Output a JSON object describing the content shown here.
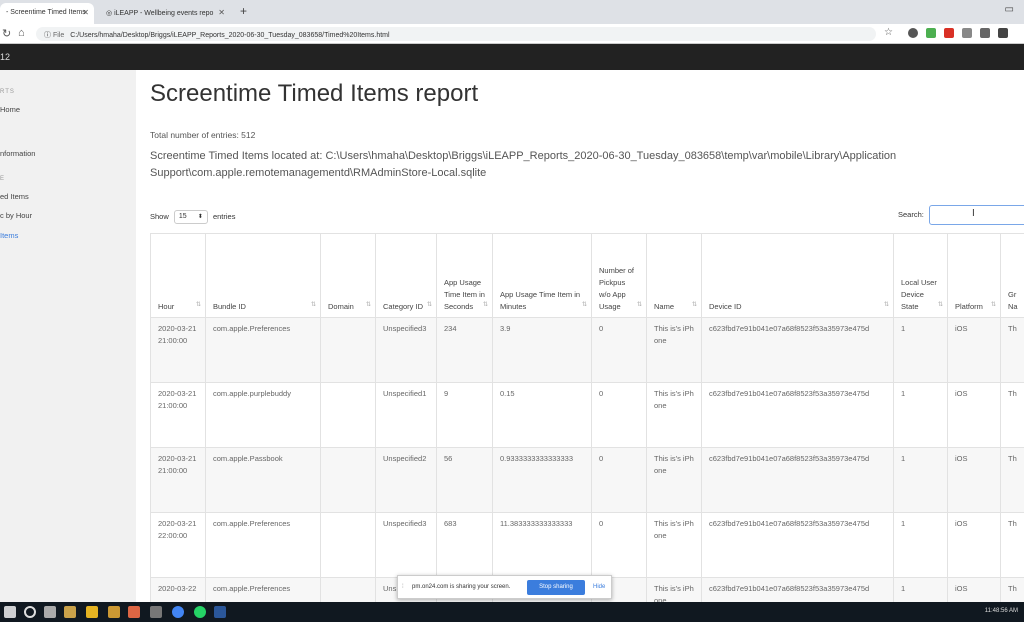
{
  "browser": {
    "tabs": [
      {
        "label": "- Screentime Timed Items",
        "close": "✕"
      },
      {
        "label": "iLEAPP - Wellbeing events repo",
        "close": "✕"
      }
    ],
    "new_tab": "+",
    "url_prefix": "File",
    "url": "C:/Users/hmaha/Desktop/Briggs/iLEAPP_Reports_2020-06-30_Tuesday_083658/Timed%20Items.html"
  },
  "page": {
    "brand": "12",
    "sidebar": [
      {
        "label": "RTS",
        "type": "head"
      },
      {
        "label": "Home",
        "type": "item"
      },
      {
        "label": "nformation",
        "type": "item"
      },
      {
        "label": "E",
        "type": "head"
      },
      {
        "label": "ed Items",
        "type": "item"
      },
      {
        "label": "c by Hour",
        "type": "item"
      },
      {
        "label": "Items",
        "type": "active"
      }
    ],
    "title": "Screentime Timed Items report",
    "total": "Total number of entries: 512",
    "located": "Screentime Timed Items located at: C:\\Users\\hmaha\\Desktop\\Briggs\\iLEAPP_Reports_2020-06-30_Tuesday_083658\\temp\\var\\mobile\\Library\\Application Support\\com.apple.remotemanagementd\\RMAdminStore-Local.sqlite",
    "show_label": "Show",
    "show_value": "15",
    "entries_label": "entries",
    "search_label": "Search:",
    "columns": [
      "Hour",
      "Bundle ID",
      "Domain",
      "Category ID",
      "App Usage Time Item in Seconds",
      "App Usage Time Item in Minutes",
      "Number of Pickpus w/o App Usage",
      "Name",
      "Device ID",
      "Local User Device State",
      "Platform",
      "Gr Na"
    ],
    "rows": [
      [
        "2020-03-21 21:00:00",
        "com.apple.Preferences",
        "",
        "Unspecified3",
        "234",
        "3.9",
        "0",
        "This is's iPhone",
        "c623fbd7e91b041e07a68f8523f53a35973e475d",
        "1",
        "iOS",
        "Th"
      ],
      [
        "2020-03-21 21:00:00",
        "com.apple.purplebuddy",
        "",
        "Unspecified1",
        "9",
        "0.15",
        "0",
        "This is's iPhone",
        "c623fbd7e91b041e07a68f8523f53a35973e475d",
        "1",
        "iOS",
        "Th"
      ],
      [
        "2020-03-21 21:00:00",
        "com.apple.Passbook",
        "",
        "Unspecified2",
        "56",
        "0.9333333333333333",
        "0",
        "This is's iPhone",
        "c623fbd7e91b041e07a68f8523f53a35973e475d",
        "1",
        "iOS",
        "Th"
      ],
      [
        "2020-03-21 22:00:00",
        "com.apple.Preferences",
        "",
        "Unspecified3",
        "683",
        "11.383333333333333",
        "0",
        "This is's iPhone",
        "c623fbd7e91b041e07a68f8523f53a35973e475d",
        "1",
        "iOS",
        "Th"
      ],
      [
        "2020-03-22",
        "com.apple.Preferences",
        "",
        "Uns",
        "",
        "",
        "",
        "This is's iPhone",
        "c623fbd7e91b041e07a68f8523f53a35973e475d",
        "1",
        "iOS",
        "Th"
      ]
    ]
  },
  "share_bar": {
    "message": "pm.on24.com is sharing your screen.",
    "stop": "Stop sharing",
    "hide": "Hide"
  },
  "taskbar": {
    "clock": "11:48:56 AM"
  }
}
